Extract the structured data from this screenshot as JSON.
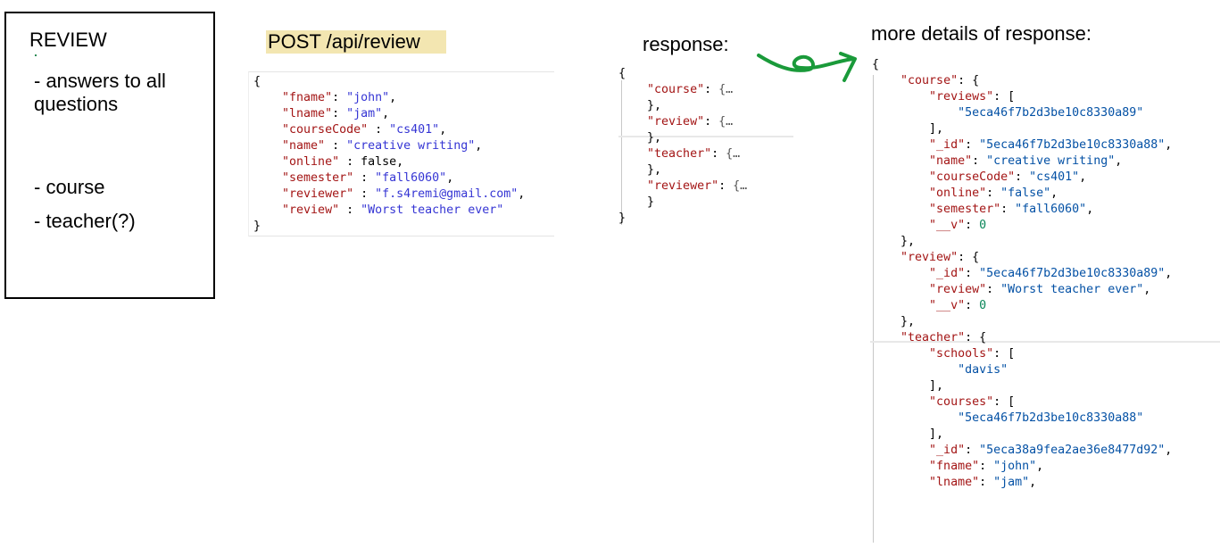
{
  "review_box": {
    "title": "REVIEW",
    "items": [
      "- answers to all questions",
      "- course",
      "- teacher(?)"
    ]
  },
  "request": {
    "heading": "POST /api/review",
    "open": "{",
    "fields": [
      {
        "key": "\"fname\"",
        "sep": ": ",
        "value": "\"john\"",
        "trail": ","
      },
      {
        "key": "\"lname\"",
        "sep": ": ",
        "value": "\"jam\"",
        "trail": ","
      },
      {
        "key": "\"courseCode\"",
        "sep": " : ",
        "value": "\"cs401\"",
        "trail": ","
      },
      {
        "key": "\"name\"",
        "sep": " : ",
        "value": "\"creative writing\"",
        "trail": ","
      },
      {
        "key": "\"online\"",
        "sep": " : ",
        "value": "false",
        "trail": ","
      },
      {
        "key": "\"semester\"",
        "sep": " : ",
        "value": "\"fall6060\"",
        "trail": ","
      },
      {
        "key": "\"reviewer\"",
        "sep": " : ",
        "value": "\"f.s4remi@gmail.com\"",
        "trail": ","
      },
      {
        "key": "\"review\"",
        "sep": " : ",
        "value": "\"Worst teacher ever\"",
        "trail": ""
      }
    ],
    "close": "}"
  },
  "response": {
    "heading": "response:",
    "open": "{",
    "keys": [
      "\"course\"",
      "\"review\"",
      "\"teacher\"",
      "\"reviewer\""
    ],
    "collapsed": "{…",
    "close_comma": "},",
    "close_last": "}",
    "close": "}"
  },
  "details": {
    "heading": "more details of response:",
    "lines": [
      {
        "t": "p",
        "i": 0,
        "text": "{"
      },
      {
        "t": "kv",
        "i": 1,
        "key": "\"course\"",
        "rest": ": {"
      },
      {
        "t": "kv",
        "i": 2,
        "key": "\"reviews\"",
        "rest": ": ["
      },
      {
        "t": "s",
        "i": 3,
        "text": "\"5eca46f7b2d3be10c8330a89\""
      },
      {
        "t": "p",
        "i": 2,
        "text": "],"
      },
      {
        "t": "kvs",
        "i": 2,
        "key": "\"_id\"",
        "val": "\"5eca46f7b2d3be10c8330a88\"",
        "end": ","
      },
      {
        "t": "kvs",
        "i": 2,
        "key": "\"name\"",
        "val": "\"creative writing\"",
        "end": ","
      },
      {
        "t": "kvs",
        "i": 2,
        "key": "\"courseCode\"",
        "val": "\"cs401\"",
        "end": ","
      },
      {
        "t": "kvs",
        "i": 2,
        "key": "\"online\"",
        "val": "\"false\"",
        "end": ","
      },
      {
        "t": "kvs",
        "i": 2,
        "key": "\"semester\"",
        "val": "\"fall6060\"",
        "end": ","
      },
      {
        "t": "kvn",
        "i": 2,
        "key": "\"__v\"",
        "val": "0",
        "end": ""
      },
      {
        "t": "p",
        "i": 1,
        "text": "},"
      },
      {
        "t": "kv",
        "i": 1,
        "key": "\"review\"",
        "rest": ": {"
      },
      {
        "t": "kvs",
        "i": 2,
        "key": "\"_id\"",
        "val": "\"5eca46f7b2d3be10c8330a89\"",
        "end": ","
      },
      {
        "t": "kvs",
        "i": 2,
        "key": "\"review\"",
        "val": "\"Worst teacher ever\"",
        "end": ","
      },
      {
        "t": "kvn",
        "i": 2,
        "key": "\"__v\"",
        "val": "0",
        "end": ""
      },
      {
        "t": "p",
        "i": 1,
        "text": "},"
      },
      {
        "t": "kv",
        "i": 1,
        "key": "\"teacher\"",
        "rest": ": {"
      },
      {
        "t": "kv",
        "i": 2,
        "key": "\"schools\"",
        "rest": ": ["
      },
      {
        "t": "s",
        "i": 3,
        "text": "\"davis\""
      },
      {
        "t": "p",
        "i": 2,
        "text": "],"
      },
      {
        "t": "kv",
        "i": 2,
        "key": "\"courses\"",
        "rest": ": ["
      },
      {
        "t": "s",
        "i": 3,
        "text": "\"5eca46f7b2d3be10c8330a88\""
      },
      {
        "t": "p",
        "i": 2,
        "text": "],"
      },
      {
        "t": "kvs",
        "i": 2,
        "key": "\"_id\"",
        "val": "\"5eca38a9fea2ae36e8477d92\"",
        "end": ","
      },
      {
        "t": "kvs",
        "i": 2,
        "key": "\"fname\"",
        "val": "\"john\"",
        "end": ","
      },
      {
        "t": "kvs",
        "i": 2,
        "key": "\"lname\"",
        "val": "\"jam\"",
        "end": ","
      }
    ]
  },
  "colors": {
    "key": "#a31515",
    "string": "#0451a5",
    "number": "#098658",
    "highlight": "#f3e6b1",
    "arrow": "#1a9a3a"
  }
}
